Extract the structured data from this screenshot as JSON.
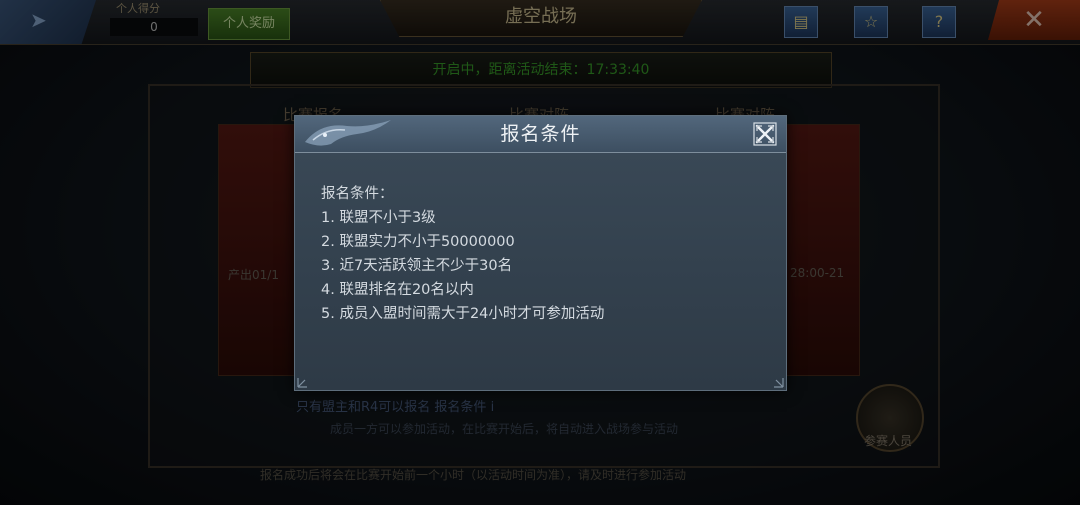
{
  "background": {
    "score_label": "个人得分",
    "score_value": "0",
    "personal_button": "个人奖励",
    "page_title": "虚空战场",
    "status_text": "开启中，距离活动结束：17:33:40",
    "tabs": [
      "比赛报名",
      "比赛对阵",
      "比赛对阵"
    ],
    "left_side_text": "产出01/1",
    "right_side_text": "28:00-21",
    "bottom_line1": "只有盟主和R4可以报名  报名条件  i",
    "bottom_line2": "成员一方可以参加活动，在比赛开始后，将自动进入战场参与活动",
    "bottom_line3": "报名成功后将会在比赛开始前一个小时（以活动时间为准），请及时进行参加活动",
    "participants_label": "参赛人员",
    "icons": [
      "mail-icon",
      "trophy-icon",
      "help-icon",
      "close-icon"
    ]
  },
  "modal": {
    "title": "报名条件",
    "heading": "报名条件：",
    "conditions": [
      "1. 联盟不小于3级",
      "2. 联盟实力不小于50000000",
      "3. 近7天活跃领主不少于30名",
      "4. 联盟排名在20名以内",
      "5. 成员入盟时间需大于24小时才可参加活动"
    ],
    "close_icon": "crossed-swords-close-icon"
  },
  "colors": {
    "modal_bg": "#36444f",
    "header_bg": "#4a5d70",
    "title_text": "#eef1f4",
    "body_text": "#d4dae0"
  }
}
